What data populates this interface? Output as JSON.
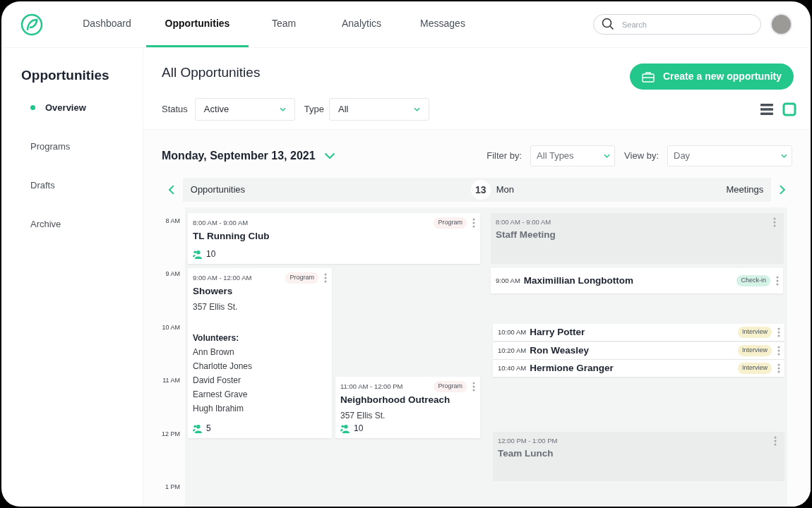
{
  "nav": {
    "tabs": [
      {
        "label": "Dashboard",
        "selected": false
      },
      {
        "label": "Opportunities",
        "selected": true
      },
      {
        "label": "Team",
        "selected": false
      },
      {
        "label": "Analytics",
        "selected": false
      },
      {
        "label": "Messages",
        "selected": false
      }
    ],
    "search": {
      "placeholder": "Search"
    }
  },
  "sidebar": {
    "title": "Opportunities",
    "items": [
      {
        "label": "Overview",
        "selected": true
      },
      {
        "label": "Programs",
        "selected": false
      },
      {
        "label": "Drafts",
        "selected": false
      },
      {
        "label": "Archive",
        "selected": false
      }
    ]
  },
  "header": {
    "title": "All Opportunities",
    "create_button": "Create a new opportunity",
    "filters": [
      {
        "label": "Status",
        "value": "Active"
      },
      {
        "label": "Type",
        "value": "All"
      }
    ],
    "view_modes": [
      {
        "kind": "list",
        "selected": false
      },
      {
        "kind": "calendar",
        "selected": true
      }
    ]
  },
  "calendar": {
    "date": "Monday, September 13, 2021",
    "filter_by": {
      "label": "Filter by:",
      "value": "All Types"
    },
    "view_by": {
      "label": "View by:",
      "value": "Day"
    },
    "left_heading": "Opportunities",
    "day_number": "13",
    "day_name": "Mon",
    "right_heading": "Meetings",
    "hours": [
      "8 AM",
      "9 AM",
      "10 AM",
      "11 AM",
      "12 PM",
      "1 PM"
    ],
    "opportunities": [
      {
        "time": "8:00 AM - 9:00 AM",
        "tag": "Program",
        "title": "TL Running Club",
        "count": "10"
      },
      {
        "time": "9:00 AM - 12:00 AM",
        "tag": "Program",
        "title": "Showers",
        "address": "357 Ellis St.",
        "volunteers_label": "Volunteers:",
        "volunteers": [
          "Ann Brown",
          "Charlotte Jones",
          "David Foster",
          "Earnest Grave",
          "Hugh Ibrahim"
        ],
        "count": "5"
      },
      {
        "time": "11:00 AM - 12:00 PM",
        "tag": "Program",
        "title": "Neighborhood Outreach",
        "address": "357 Ellis St.",
        "count": "10"
      }
    ],
    "meetings": [
      {
        "kind": "block",
        "time": "8:00 AM - 9:00 AM",
        "title": "Staff Meeting"
      },
      {
        "kind": "row",
        "time": "9:00 AM",
        "title": "Maximillian Longbottom",
        "tag": "Check-in",
        "color": "#d5f2e7"
      },
      {
        "kind": "row",
        "time": "10:00 AM",
        "title": "Harry Potter",
        "tag": "Interview",
        "color": "#f6f1cc"
      },
      {
        "kind": "row",
        "time": "10:20 AM",
        "title": "Ron Weasley",
        "tag": "Interview",
        "color": "#f6f1cc"
      },
      {
        "kind": "row",
        "time": "10:40 AM",
        "title": "Hermione Granger",
        "tag": "Interview",
        "color": "#f6f1cc"
      },
      {
        "kind": "block",
        "time": "12:00 PM - 1:00 PM",
        "title": "Team Lunch"
      }
    ]
  }
}
